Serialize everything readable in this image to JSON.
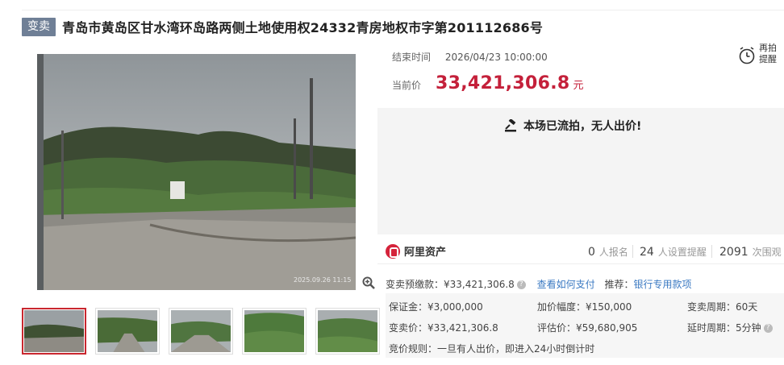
{
  "header": {
    "tag": "变卖",
    "title": "青岛市黄岛区甘水湾环岛路两侧土地使用权24332青房地权市字第201112686号"
  },
  "gallery": {
    "photo_timestamp": "2025.09.26 11:15",
    "thumb_count": 5
  },
  "auction": {
    "end_label": "结束时间",
    "end_value": "2026/04/23 10:00:00",
    "price_label": "当前价",
    "price_value": "33,421,306.8",
    "price_unit": "元",
    "remind_line1": "再拍",
    "remind_line2": "提醒",
    "status": "本场已流拍，无人出价!"
  },
  "stats": {
    "brand": "阿里资产",
    "signup_count": "0",
    "signup_label": "人报名",
    "reminder_count": "24",
    "reminder_label": "人设置提醒",
    "view_count": "2091",
    "view_label": "次围观"
  },
  "details": {
    "prepay_label": "变卖预缴款：¥33,421,306.8",
    "howto_link": "查看如何支付",
    "recommend_label": "推荐：",
    "bank_link": "银行专用款项",
    "deposit": "保证金：¥3,000,000",
    "increment": "加价幅度：¥150,000",
    "period": "变卖周期：60天",
    "sale_price": "变卖价：¥33,421,306.8",
    "appraisal": "评估价：¥59,680,905",
    "delay": "延时周期：5分钟",
    "rule": "竞价规则：一旦有人出价，即进入24小时倒计时"
  },
  "colors": {
    "accent": "#c4203a",
    "tag_bg": "#6f7f96",
    "link": "#3a79c2"
  }
}
